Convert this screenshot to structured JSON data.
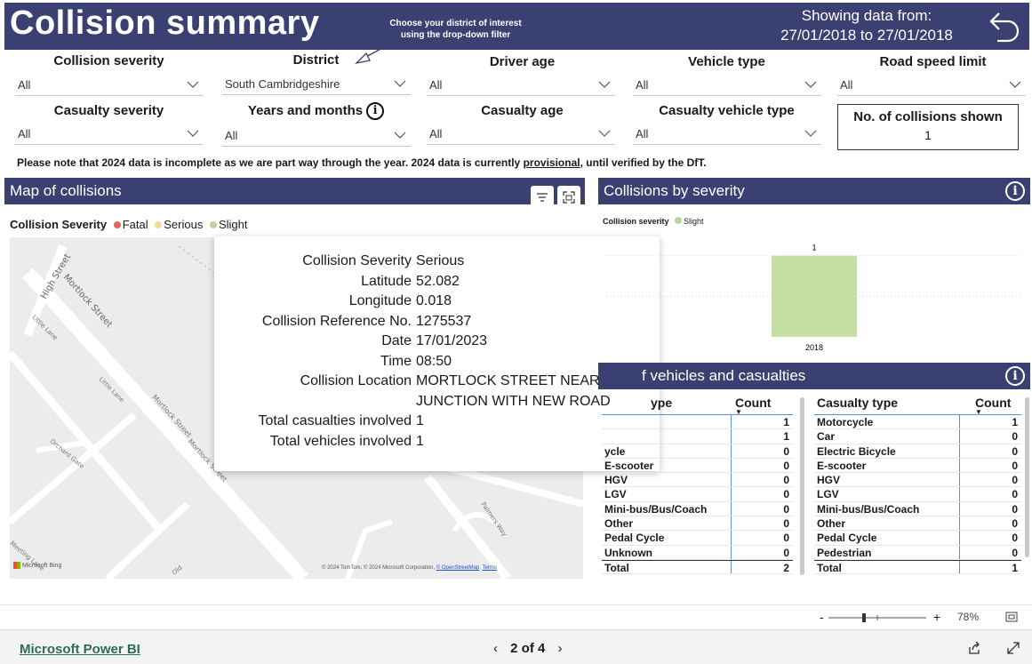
{
  "header": {
    "title": "Collision summary",
    "hint": "Choose your district of interest using the drop-down filter",
    "showing_label": "Showing data from:",
    "date_range": "27/01/2018  to 27/01/2018"
  },
  "filters": {
    "collision_severity": {
      "label": "Collision severity",
      "value": "All"
    },
    "district": {
      "label": "District",
      "value": "South Cambridgeshire"
    },
    "driver_age": {
      "label": "Driver age",
      "value": "All"
    },
    "vehicle_type": {
      "label": "Vehicle type",
      "value": "All"
    },
    "road_speed_limit": {
      "label": "Road speed limit",
      "value": "All"
    },
    "casualty_severity": {
      "label": "Casualty severity",
      "value": "All"
    },
    "years_months": {
      "label": "Years and months",
      "value": "All"
    },
    "casualty_age": {
      "label": "Casualty age",
      "value": "All"
    },
    "casualty_vehicle_type": {
      "label": "Casualty vehicle type",
      "value": "All"
    }
  },
  "collision_count": {
    "label": "No. of collisions shown",
    "value": "1"
  },
  "note": {
    "before": "Please note that 2024 data is incomplete as we are part way through the year. 2024 data is currently ",
    "link": "provisional",
    "after": ", until verified by the DfT."
  },
  "map_panel": {
    "title": "Map of collisions",
    "legend_title": "Collision Severity",
    "legend": [
      {
        "label": "Fatal",
        "color": "#e8645a"
      },
      {
        "label": "Serious",
        "color": "#f5d98b"
      },
      {
        "label": "Slight",
        "color": "#b5d69c"
      }
    ],
    "streets": [
      "High Street",
      "Mortlock Street",
      "Little Lane",
      "Little Lane",
      "Mortlock Street",
      "Mortlock Street",
      "Orchard Gate",
      "Palmers Way",
      "Old",
      "Meeting Lane"
    ],
    "attribution": "© 2024 TomTom, © 2024 Microsoft Corporation, ",
    "attribution_link": "© OpenStreetMap",
    "terms": "Terms",
    "bing": "Microsoft Bing"
  },
  "tooltip": [
    {
      "k": "Collision Severity",
      "v": "Serious"
    },
    {
      "k": "Latitude",
      "v": "52.082"
    },
    {
      "k": "Longitude",
      "v": "0.018"
    },
    {
      "k": "Collision Reference No.",
      "v": "1275537"
    },
    {
      "k": "Date",
      "v": "17/01/2023"
    },
    {
      "k": "Time",
      "v": "08:50"
    },
    {
      "k": "Collision Location",
      "v": "MORTLOCK STREET NEAR JUNCTION WITH NEW ROAD"
    },
    {
      "k": "Total casualties involved",
      "v": "1"
    },
    {
      "k": "Total vehicles involved",
      "v": "1"
    }
  ],
  "severity_panel": {
    "title": "Collisions by severity",
    "legend_title": "Collision severity",
    "legend_item": "Slight",
    "legend_color": "#b5d69c"
  },
  "chart_data": {
    "type": "bar",
    "categories": [
      "2018"
    ],
    "series": [
      {
        "name": "Slight",
        "values": [
          1
        ],
        "color": "#c5dfa5"
      }
    ],
    "ylim": [
      0,
      1.15
    ],
    "data_labels": [
      "1"
    ]
  },
  "vc_panel": {
    "title_visible": "f vehicles and casualties"
  },
  "vehicle_table": {
    "headers": [
      "ype",
      "Count"
    ],
    "rows": [
      [
        "",
        "1"
      ],
      [
        "",
        "1"
      ],
      [
        "ycle",
        "0"
      ],
      [
        "E-scooter",
        "0"
      ],
      [
        "HGV",
        "0"
      ],
      [
        "LGV",
        "0"
      ],
      [
        "Mini-bus/Bus/Coach",
        "0"
      ],
      [
        "Other",
        "0"
      ],
      [
        "Pedal Cycle",
        "0"
      ],
      [
        "Unknown",
        "0"
      ]
    ],
    "total": [
      "Total",
      "2"
    ]
  },
  "casualty_table": {
    "headers": [
      "Casualty type",
      "Count"
    ],
    "rows": [
      [
        "Motorcycle",
        "1"
      ],
      [
        "Car",
        "0"
      ],
      [
        "Electric Bicycle",
        "0"
      ],
      [
        "E-scooter",
        "0"
      ],
      [
        "HGV",
        "0"
      ],
      [
        "LGV",
        "0"
      ],
      [
        "Mini-bus/Bus/Coach",
        "0"
      ],
      [
        "Other",
        "0"
      ],
      [
        "Pedal Cycle",
        "0"
      ],
      [
        "Pedestrian",
        "0"
      ]
    ],
    "total": [
      "Total",
      "1"
    ]
  },
  "zoom": {
    "minus": "-",
    "plus": "+",
    "level": "78%"
  },
  "footer": {
    "brand": "Microsoft Power BI",
    "page": "2 of 4",
    "prev": "‹",
    "next": "›"
  }
}
